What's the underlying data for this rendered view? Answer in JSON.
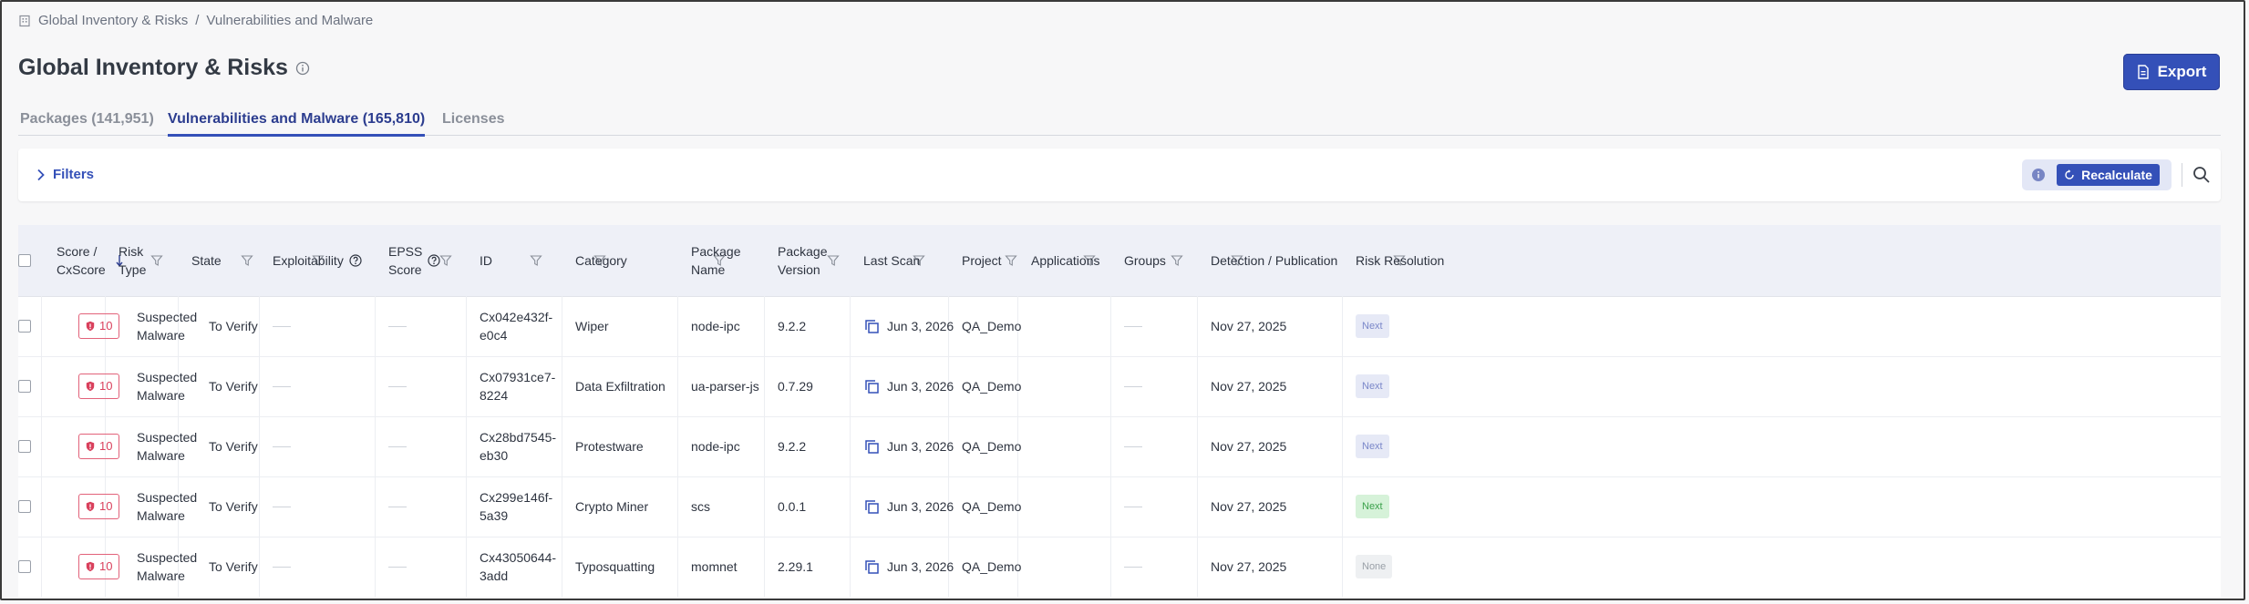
{
  "breadcrumb": {
    "items": [
      "Global Inventory & Risks",
      "Vulnerabilities and Malware"
    ],
    "separator": "/"
  },
  "page": {
    "title": "Global Inventory & Risks"
  },
  "toolbar": {
    "export_label": "Export",
    "filters_label": "Filters",
    "recalculate_label": "Recalculate"
  },
  "tabs": [
    {
      "label": "Packages (141,951)",
      "active": false
    },
    {
      "label": "Vulnerabilities and Malware (165,810)",
      "active": true
    },
    {
      "label": "Licenses",
      "active": false
    }
  ],
  "table": {
    "columns": [
      {
        "key": "score",
        "line1": "Score /",
        "line2": "CxScore",
        "sorted": "desc"
      },
      {
        "key": "risk_type",
        "line1": "Risk",
        "line2": "Type"
      },
      {
        "key": "state",
        "line1": "State",
        "line2": ""
      },
      {
        "key": "exploitability",
        "line1": "Exploitability",
        "line2": "",
        "help": true
      },
      {
        "key": "epss",
        "line1": "EPSS",
        "line2": "Score",
        "help": true
      },
      {
        "key": "id",
        "line1": "ID",
        "line2": ""
      },
      {
        "key": "category",
        "line1": "Category",
        "line2": ""
      },
      {
        "key": "package_name",
        "line1": "Package",
        "line2": "Name"
      },
      {
        "key": "package_version",
        "line1": "Package",
        "line2": "Version"
      },
      {
        "key": "last_scan",
        "line1": "Last Scan",
        "line2": ""
      },
      {
        "key": "project",
        "line1": "Project",
        "line2": ""
      },
      {
        "key": "applications",
        "line1": "Applications",
        "line2": ""
      },
      {
        "key": "groups",
        "line1": "Groups",
        "line2": ""
      },
      {
        "key": "detection",
        "line1": "Detection / Publication",
        "line2": ""
      },
      {
        "key": "risk_resolution",
        "line1": "Risk Resolution",
        "line2": ""
      }
    ],
    "rows": [
      {
        "score": "10",
        "risk_type_1": "Suspected",
        "risk_type_2": "Malware",
        "state": "To Verify",
        "id_1": "Cx042e432f-",
        "id_2": "e0c4",
        "category": "Wiper",
        "package_name": "node-ipc",
        "package_version": "9.2.2",
        "last_scan": "Jun 3, 2026",
        "project": "QA_Demo",
        "detection": "Nov 27, 2025",
        "resolution": "Next",
        "resolution_style": "next"
      },
      {
        "score": "10",
        "risk_type_1": "Suspected",
        "risk_type_2": "Malware",
        "state": "To Verify",
        "id_1": "Cx07931ce7-",
        "id_2": "8224",
        "category": "Data Exfiltration",
        "package_name": "ua-parser-js",
        "package_version": "0.7.29",
        "last_scan": "Jun 3, 2026",
        "project": "QA_Demo",
        "detection": "Nov 27, 2025",
        "resolution": "Next",
        "resolution_style": "next"
      },
      {
        "score": "10",
        "risk_type_1": "Suspected",
        "risk_type_2": "Malware",
        "state": "To Verify",
        "id_1": "Cx28bd7545-",
        "id_2": "eb30",
        "category": "Protestware",
        "package_name": "node-ipc",
        "package_version": "9.2.2",
        "last_scan": "Jun 3, 2026",
        "project": "QA_Demo",
        "detection": "Nov 27, 2025",
        "resolution": "Next",
        "resolution_style": "next"
      },
      {
        "score": "10",
        "risk_type_1": "Suspected",
        "risk_type_2": "Malware",
        "state": "To Verify",
        "id_1": "Cx299e146f-",
        "id_2": "5a39",
        "category": "Crypto Miner",
        "package_name": "scs",
        "package_version": "0.0.1",
        "last_scan": "Jun 3, 2026",
        "project": "QA_Demo",
        "detection": "Nov 27, 2025",
        "resolution": "Next",
        "resolution_style": "next-green"
      },
      {
        "score": "10",
        "risk_type_1": "Suspected",
        "risk_type_2": "Malware",
        "state": "To Verify",
        "id_1": "Cx43050644-",
        "id_2": "3add",
        "category": "Typosquatting",
        "package_name": "momnet",
        "package_version": "2.29.1",
        "last_scan": "Jun 3, 2026",
        "project": "QA_Demo",
        "detection": "Nov 27, 2025",
        "resolution": "None",
        "resolution_style": "none"
      }
    ]
  },
  "colors": {
    "accent": "#3450b8",
    "score_red": "#d9405c",
    "header_bg": "#eef0f7",
    "page_bg": "#f7f7f8"
  },
  "icons": {
    "home": "building-icon",
    "info": "info-icon",
    "export": "document-icon",
    "filters": "chevron-right-icon",
    "recalculate": "refresh-icon",
    "search": "search-icon",
    "filter": "funnel-icon",
    "help": "question-icon",
    "score": "shield-icon",
    "scan": "copy-icon"
  }
}
